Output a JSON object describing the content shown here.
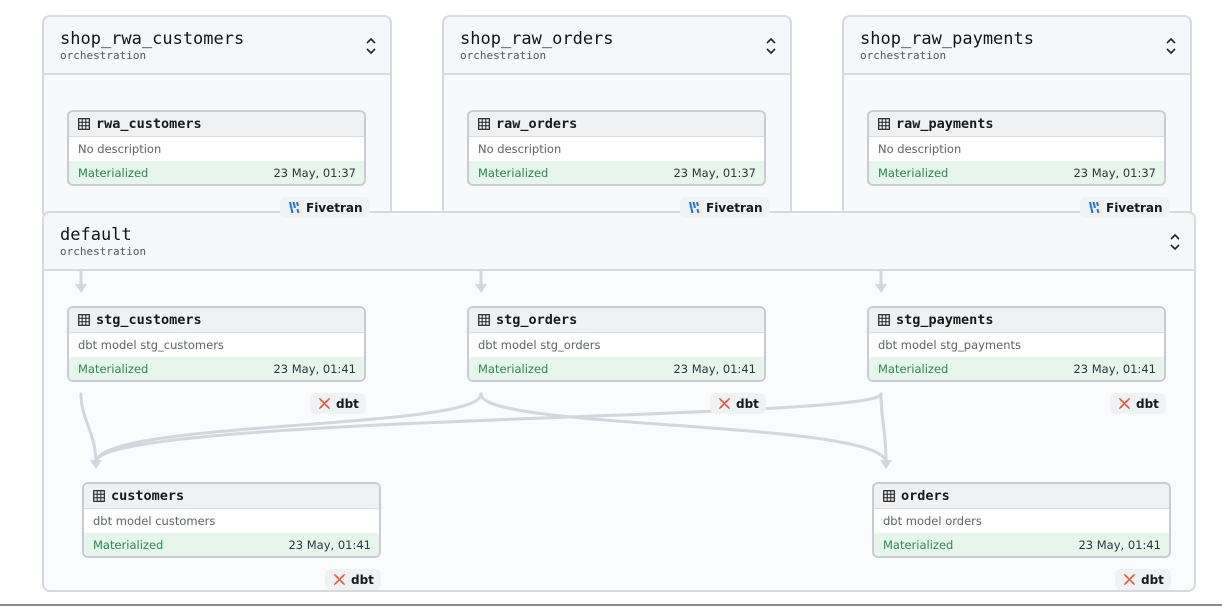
{
  "groups": {
    "shop_rwa_customers": {
      "title": "shop_rwa_customers",
      "subtitle": "orchestration"
    },
    "shop_raw_orders": {
      "title": "shop_raw_orders",
      "subtitle": "orchestration"
    },
    "shop_raw_payments": {
      "title": "shop_raw_payments",
      "subtitle": "orchestration"
    },
    "default": {
      "title": "default",
      "subtitle": "orchestration"
    }
  },
  "nodes": {
    "rwa_customers": {
      "name": "rwa_customers",
      "description": "No description",
      "status": "Materialized",
      "time": "23 May, 01:37",
      "kind": "Fivetran"
    },
    "raw_orders": {
      "name": "raw_orders",
      "description": "No description",
      "status": "Materialized",
      "time": "23 May, 01:37",
      "kind": "Fivetran"
    },
    "raw_payments": {
      "name": "raw_payments",
      "description": "No description",
      "status": "Materialized",
      "time": "23 May, 01:37",
      "kind": "Fivetran"
    },
    "stg_customers": {
      "name": "stg_customers",
      "description": "dbt model stg_customers",
      "status": "Materialized",
      "time": "23 May, 01:41",
      "kind": "dbt"
    },
    "stg_orders": {
      "name": "stg_orders",
      "description": "dbt model stg_orders",
      "status": "Materialized",
      "time": "23 May, 01:41",
      "kind": "dbt"
    },
    "stg_payments": {
      "name": "stg_payments",
      "description": "dbt model stg_payments",
      "status": "Materialized",
      "time": "23 May, 01:41",
      "kind": "dbt"
    },
    "customers": {
      "name": "customers",
      "description": "dbt model customers",
      "status": "Materialized",
      "time": "23 May, 01:41",
      "kind": "dbt"
    },
    "orders": {
      "name": "orders",
      "description": "dbt model orders",
      "status": "Materialized",
      "time": "23 May, 01:41",
      "kind": "dbt"
    }
  },
  "icons": {
    "asset": "table-icon",
    "collapse": "chevron-up-down-icon",
    "fivetran": "fivetran-logo-icon",
    "dbt": "dbt-logo-icon"
  },
  "colors": {
    "status_bg": "#e6f6ec",
    "status_text": "#2a8a4d",
    "fivetran": "#1f6fe5",
    "dbt": "#f0533a",
    "edge": "#d3d6dc"
  }
}
